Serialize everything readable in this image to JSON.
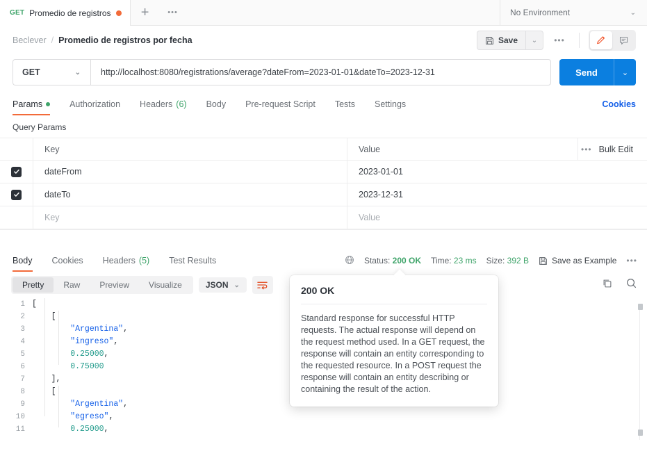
{
  "tabstrip": {
    "tab": {
      "method": "GET",
      "name": "Promedio de registros",
      "unsaved_dot": "●"
    },
    "new_tab": "+",
    "more": "•••",
    "environment": {
      "label": "No Environment",
      "caret": "⌄"
    }
  },
  "breadcrumb": {
    "parent": "Beclever",
    "separator": "/",
    "current": "Promedio de registros por fecha"
  },
  "actions": {
    "save_label": "Save",
    "save_caret": "⌄",
    "more": "•••"
  },
  "request": {
    "method": "GET",
    "method_caret": "⌄",
    "url": "http://localhost:8080/registrations/average?dateFrom=2023-01-01&dateTo=2023-12-31",
    "send_label": "Send",
    "send_caret": "⌄",
    "tabs": [
      {
        "label": "Params",
        "dot": true,
        "active": true
      },
      {
        "label": "Authorization",
        "active": false
      },
      {
        "label": "Headers",
        "count": "(6)",
        "active": false
      },
      {
        "label": "Body",
        "active": false
      },
      {
        "label": "Pre-request Script",
        "active": false
      },
      {
        "label": "Tests",
        "active": false
      },
      {
        "label": "Settings",
        "active": false
      }
    ],
    "cookies_link": "Cookies"
  },
  "params": {
    "section_label": "Query Params",
    "columns": {
      "key": "Key",
      "value": "Value"
    },
    "bulk_edit": "Bulk Edit",
    "more": "•••",
    "rows": [
      {
        "checked": true,
        "key": "dateFrom",
        "value": "2023-01-01"
      },
      {
        "checked": true,
        "key": "dateTo",
        "value": "2023-12-31"
      }
    ],
    "empty_row": {
      "key_placeholder": "Key",
      "value_placeholder": "Value"
    }
  },
  "response": {
    "tabs": [
      {
        "label": "Body",
        "active": true
      },
      {
        "label": "Cookies",
        "active": false
      },
      {
        "label": "Headers",
        "count": "(5)",
        "active": false
      },
      {
        "label": "Test Results",
        "active": false
      }
    ],
    "status_label": "Status:",
    "status_value": "200 OK",
    "time_label": "Time:",
    "time_value": "23 ms",
    "size_label": "Size:",
    "size_value": "392 B",
    "save_as_example": "Save as Example",
    "more": "•••",
    "view_modes": [
      {
        "label": "Pretty",
        "active": true
      },
      {
        "label": "Raw",
        "active": false
      },
      {
        "label": "Preview",
        "active": false
      },
      {
        "label": "Visualize",
        "active": false
      }
    ],
    "format": {
      "label": "JSON",
      "caret": "⌄"
    },
    "body_lines": [
      {
        "n": "1",
        "tokens": [
          {
            "t": "[",
            "c": "punct"
          }
        ],
        "indent": 0
      },
      {
        "n": "2",
        "tokens": [
          {
            "t": "[",
            "c": "punct"
          }
        ],
        "indent": 1
      },
      {
        "n": "3",
        "tokens": [
          {
            "t": "\"Argentina\"",
            "c": "str"
          },
          {
            "t": ",",
            "c": "punct"
          }
        ],
        "indent": 2
      },
      {
        "n": "4",
        "tokens": [
          {
            "t": "\"ingreso\"",
            "c": "str"
          },
          {
            "t": ",",
            "c": "punct"
          }
        ],
        "indent": 2
      },
      {
        "n": "5",
        "tokens": [
          {
            "t": "0.25000",
            "c": "num"
          },
          {
            "t": ",",
            "c": "punct"
          }
        ],
        "indent": 2
      },
      {
        "n": "6",
        "tokens": [
          {
            "t": "0.75000",
            "c": "num"
          }
        ],
        "indent": 2
      },
      {
        "n": "7",
        "tokens": [
          {
            "t": "],",
            "c": "punct"
          }
        ],
        "indent": 1
      },
      {
        "n": "8",
        "tokens": [
          {
            "t": "[",
            "c": "punct"
          }
        ],
        "indent": 1
      },
      {
        "n": "9",
        "tokens": [
          {
            "t": "\"Argentina\"",
            "c": "str"
          },
          {
            "t": ",",
            "c": "punct"
          }
        ],
        "indent": 2
      },
      {
        "n": "10",
        "tokens": [
          {
            "t": "\"egreso\"",
            "c": "str"
          },
          {
            "t": ",",
            "c": "punct"
          }
        ],
        "indent": 2
      },
      {
        "n": "11",
        "tokens": [
          {
            "t": "0.25000",
            "c": "num"
          },
          {
            "t": ",",
            "c": "punct"
          }
        ],
        "indent": 2
      }
    ]
  },
  "tooltip": {
    "title": "200 OK",
    "text": "Standard response for successful HTTP requests. The actual response will depend on the request method used. In a GET request, the response will contain an entity corresponding to the requested resource. In a POST request the response will contain an entity describing or containing the result of the action."
  },
  "colors": {
    "accent_orange": "#f26b3a",
    "send_blue": "#0b7fe0",
    "link_blue": "#1560e8",
    "success_green": "#3fa46a",
    "string_blue": "#1560e8",
    "number_teal": "#1f9a8a"
  }
}
